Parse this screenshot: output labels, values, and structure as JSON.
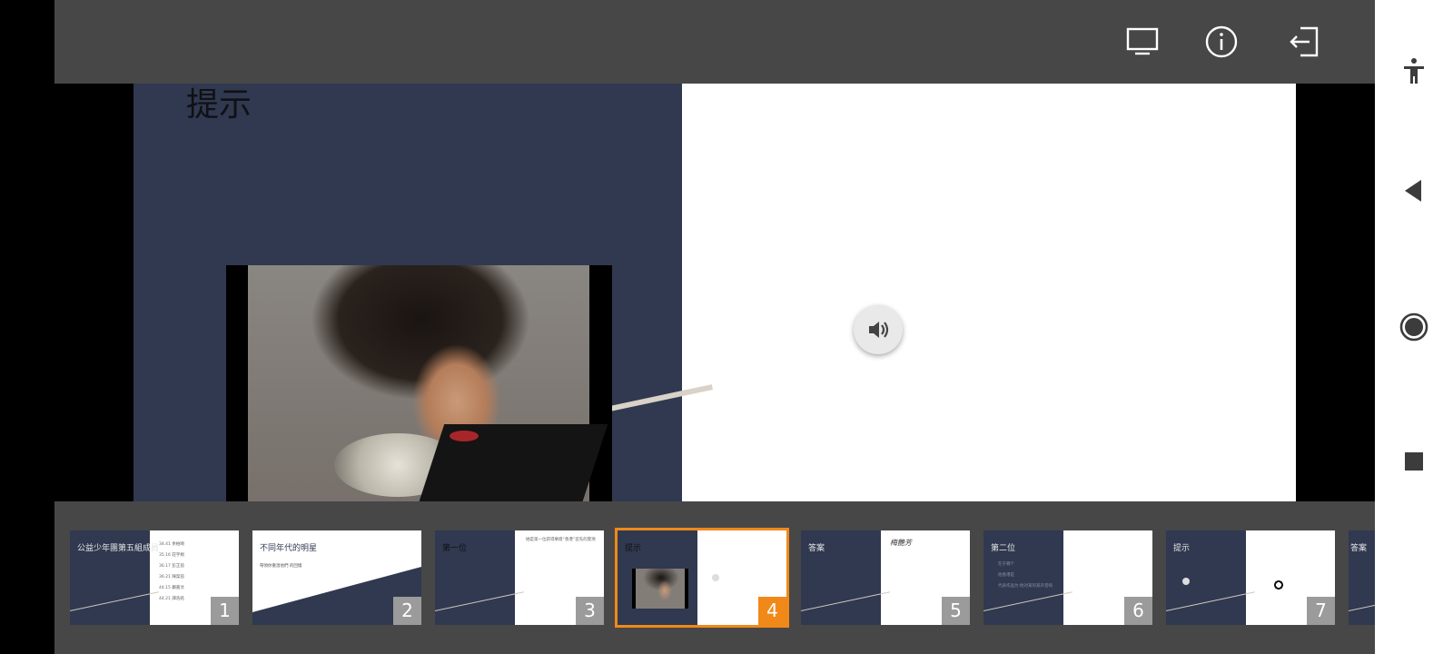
{
  "toolbar": {
    "icons": [
      "present-screen-icon",
      "info-icon",
      "exit-icon"
    ]
  },
  "slide": {
    "title": "提示",
    "audio_icon": "speaker-icon"
  },
  "thumbnails": [
    {
      "number": "1",
      "title": "公益少年團第五組成員",
      "active": false,
      "lines": [
        "34.41 余柏頤",
        "35.16 莊宇桐",
        "36.17 彭芷茵",
        "36.21 陳棨茵",
        "44.15 鄺嘉汶",
        "44.21 譚浩銘"
      ]
    },
    {
      "number": "2",
      "title": "不同年代的明星",
      "active": false,
      "subtitle": "帶領你重溫他們 的回憶"
    },
    {
      "number": "3",
      "title": "第一位",
      "active": false,
      "lines": [
        "她是第一位获得樂壇“香港”首先的獎項"
      ]
    },
    {
      "number": "4",
      "title": "提示",
      "active": true
    },
    {
      "number": "5",
      "title": "答案",
      "active": false,
      "right_text": "梅艷芳"
    },
    {
      "number": "6",
      "title": "第二位",
      "active": false,
      "lines": [
        "在于哪个",
        "他香港是",
        "代表作品为:他对某的某声音响"
      ]
    },
    {
      "number": "7",
      "title": "提示",
      "active": false
    },
    {
      "number": "",
      "title": "答案",
      "active": false
    }
  ],
  "navbar": {
    "icons": [
      "accessibility-icon",
      "back-icon",
      "home-icon",
      "recents-icon"
    ]
  },
  "colors": {
    "slide_dark": "#303950",
    "bar": "#474747",
    "accent": "#f0891a"
  }
}
